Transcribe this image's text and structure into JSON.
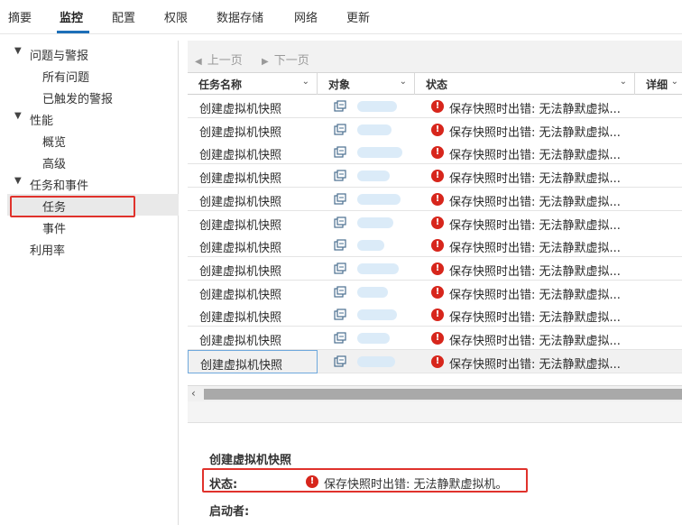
{
  "top_tabs": [
    {
      "label": "摘要"
    },
    {
      "label": "监控"
    },
    {
      "label": "配置"
    },
    {
      "label": "权限"
    },
    {
      "label": "数据存储"
    },
    {
      "label": "网络"
    },
    {
      "label": "更新"
    }
  ],
  "active_tab": "监控",
  "sidebar": {
    "items": [
      {
        "label": "问题与警报",
        "expandable": true,
        "expanded": true
      },
      {
        "label": "所有问题"
      },
      {
        "label": "已触发的警报"
      },
      {
        "label": "性能",
        "expandable": true,
        "expanded": true
      },
      {
        "label": "概览"
      },
      {
        "label": "高级"
      },
      {
        "label": "任务和事件",
        "expandable": true,
        "expanded": true
      },
      {
        "label": "任务",
        "selected": true
      },
      {
        "label": "事件"
      },
      {
        "label": "利用率"
      }
    ]
  },
  "pager": {
    "prev_label": "上一页",
    "next_label": "下一页"
  },
  "table": {
    "columns": [
      {
        "label": "任务名称"
      },
      {
        "label": "对象"
      },
      {
        "label": "状态"
      },
      {
        "label": "详细"
      }
    ],
    "rows": [
      {
        "name": "创建虚拟机快照",
        "status": "保存快照时出错: 无法静默虚拟..."
      },
      {
        "name": "创建虚拟机快照",
        "status": "保存快照时出错: 无法静默虚拟..."
      },
      {
        "name": "创建虚拟机快照",
        "status": "保存快照时出错: 无法静默虚拟..."
      },
      {
        "name": "创建虚拟机快照",
        "status": "保存快照时出错: 无法静默虚拟..."
      },
      {
        "name": "创建虚拟机快照",
        "status": "保存快照时出错: 无法静默虚拟..."
      },
      {
        "name": "创建虚拟机快照",
        "status": "保存快照时出错: 无法静默虚拟..."
      },
      {
        "name": "创建虚拟机快照",
        "status": "保存快照时出错: 无法静默虚拟..."
      },
      {
        "name": "创建虚拟机快照",
        "status": "保存快照时出错: 无法静默虚拟..."
      },
      {
        "name": "创建虚拟机快照",
        "status": "保存快照时出错: 无法静默虚拟..."
      },
      {
        "name": "创建虚拟机快照",
        "status": "保存快照时出错: 无法静默虚拟..."
      },
      {
        "name": "创建虚拟机快照",
        "status": "保存快照时出错: 无法静默虚拟..."
      },
      {
        "name": "创建虚拟机快照",
        "status": "保存快照时出错: 无法静默虚拟...",
        "selected": true
      }
    ]
  },
  "detail": {
    "title": "创建虚拟机快照",
    "status_key": "状态:",
    "status_value": "保存快照时出错: 无法静默虚拟机。",
    "initiator_key": "启动者:"
  },
  "colors": {
    "accent": "#1d6fb8",
    "error": "#d7261c",
    "highlight_box": "#e0322c"
  },
  "icons": {
    "vm": "vm-icon",
    "error": "error-icon",
    "expand": "caret-down-icon"
  }
}
